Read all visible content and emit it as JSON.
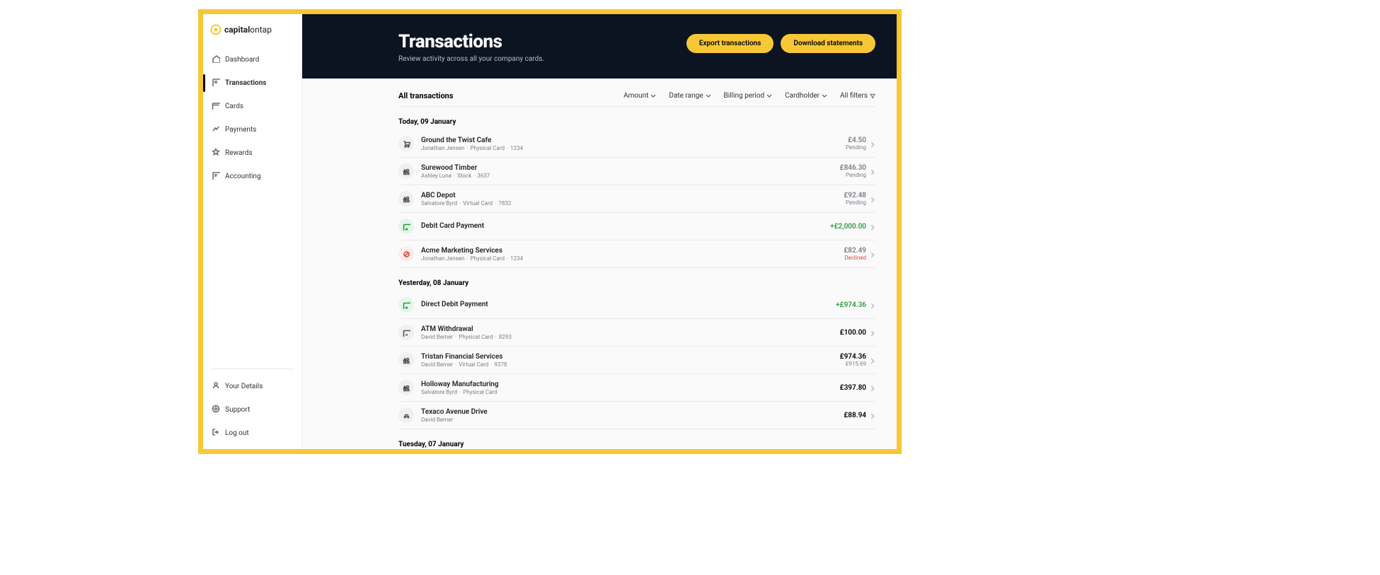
{
  "brand": {
    "name_a": "capital",
    "name_b": "ontap"
  },
  "sidebar": {
    "nav": [
      {
        "label": "Dashboard",
        "icon": "home",
        "active": false
      },
      {
        "label": "Transactions",
        "icon": "receipt",
        "active": true
      },
      {
        "label": "Cards",
        "icon": "card",
        "active": false
      },
      {
        "label": "Payments",
        "icon": "payments",
        "active": false
      },
      {
        "label": "Rewards",
        "icon": "star",
        "active": false
      },
      {
        "label": "Accounting",
        "icon": "ledger",
        "active": false
      }
    ],
    "footer": [
      {
        "label": "Your Details",
        "icon": "user"
      },
      {
        "label": "Support",
        "icon": "support"
      },
      {
        "label": "Log out",
        "icon": "logout"
      }
    ]
  },
  "header": {
    "title": "Transactions",
    "subtitle": "Review activity across all your company cards.",
    "buttons": {
      "export": "Export transactions",
      "download": "Download statements"
    }
  },
  "toolbar": {
    "title": "All transactions",
    "filters": [
      {
        "label": "Amount"
      },
      {
        "label": "Date range"
      },
      {
        "label": "Billing period"
      },
      {
        "label": "Cardholder"
      },
      {
        "label": "All filters"
      }
    ]
  },
  "groups": [
    {
      "heading": "Today, 09 January",
      "rows": [
        {
          "icon": "cart",
          "title": "Ground the Twist Cafe",
          "meta": [
            "Jonathan Jensen",
            "Physical Card",
            "1234"
          ],
          "amount": "£4.50",
          "amount_class": "muted",
          "status": "Pending"
        },
        {
          "icon": "shapes",
          "title": "Surewood Timber",
          "meta": [
            "Ashley Luna",
            "Stock",
            "3637"
          ],
          "amount": "£846.30",
          "amount_class": "muted",
          "status": "Pending"
        },
        {
          "icon": "shapes",
          "title": "ABC Depot",
          "meta": [
            "Salvatore Byrd",
            "Virtual Card",
            "7832"
          ],
          "amount": "£92.48",
          "amount_class": "muted",
          "status": "Pending"
        },
        {
          "icon": "payment-in",
          "icon_class": "green",
          "title": "Debit Card Payment",
          "meta": [],
          "amount": "+£2,000.00",
          "amount_class": "green"
        },
        {
          "icon": "blocked",
          "icon_class": "red",
          "title": "Acme Marketing Services",
          "meta": [
            "Jonathan Jensen",
            "Physical Card",
            "1234"
          ],
          "amount": "£82.49",
          "amount_class": "muted",
          "status": "Declined",
          "status_class": "declined"
        }
      ]
    },
    {
      "heading": "Yesterday, 08 January",
      "rows": [
        {
          "icon": "payment-in",
          "icon_class": "green",
          "title": "Direct Debit Payment",
          "meta": [],
          "amount": "+£974.36",
          "amount_class": "green"
        },
        {
          "icon": "atm",
          "title": "ATM Withdrawal",
          "meta": [
            "David Berner",
            "Physical Card",
            "8293"
          ],
          "amount": "£100.00"
        },
        {
          "icon": "shapes",
          "title": "Tristan Financial Services",
          "meta": [
            "David Berner",
            "Virtual Card",
            "9378"
          ],
          "amount": "£974.36",
          "secondary": "£915.69"
        },
        {
          "icon": "shapes",
          "title": "Holloway Manufacturing",
          "meta": [
            "Salvatore Byrd",
            "Physical Card"
          ],
          "amount": "£397.80"
        },
        {
          "icon": "car",
          "title": "Texaco Avenue Drive",
          "meta": [
            "David Berner"
          ],
          "amount": "£88.94"
        }
      ]
    },
    {
      "heading": "Tuesday, 07 January",
      "rows": []
    }
  ]
}
